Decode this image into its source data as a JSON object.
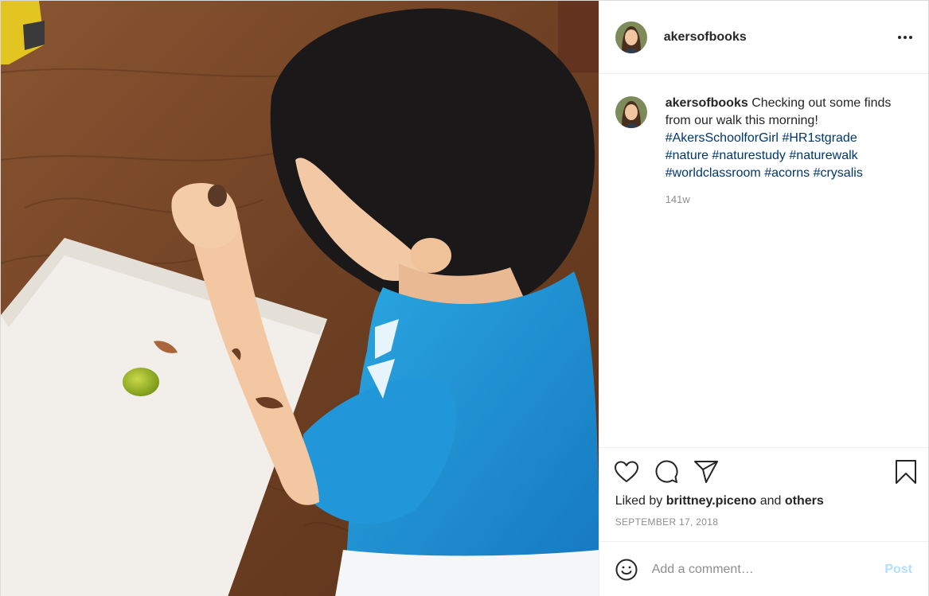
{
  "post": {
    "author": "akersofbooks",
    "more_icon": "more-horizontal-icon",
    "caption": {
      "username": "akersofbooks",
      "text": "Checking out some finds from our walk this morning!",
      "hashtags": [
        "#AkersSchoolforGirl",
        "#HR1stgrade",
        "#nature",
        "#naturestudy",
        "#naturewalk",
        "#worldclassroom",
        "#acorns",
        "#crysalis"
      ],
      "time_ago": "141w"
    },
    "actions": {
      "like_icon": "heart-icon",
      "comment_icon": "comment-icon",
      "share_icon": "paper-plane-icon",
      "save_icon": "bookmark-icon"
    },
    "likes": {
      "prefix": "Liked by",
      "user": "brittney.piceno",
      "connector": "and",
      "others": "others"
    },
    "date": "SEPTEMBER 17, 2018",
    "comment_box": {
      "emoji_icon": "smiley-icon",
      "placeholder": "Add a comment…",
      "post_label": "Post"
    },
    "colors": {
      "hashtag": "#00376b",
      "post_button_disabled": "#b2dffc",
      "muted": "#8e8e8e"
    }
  }
}
